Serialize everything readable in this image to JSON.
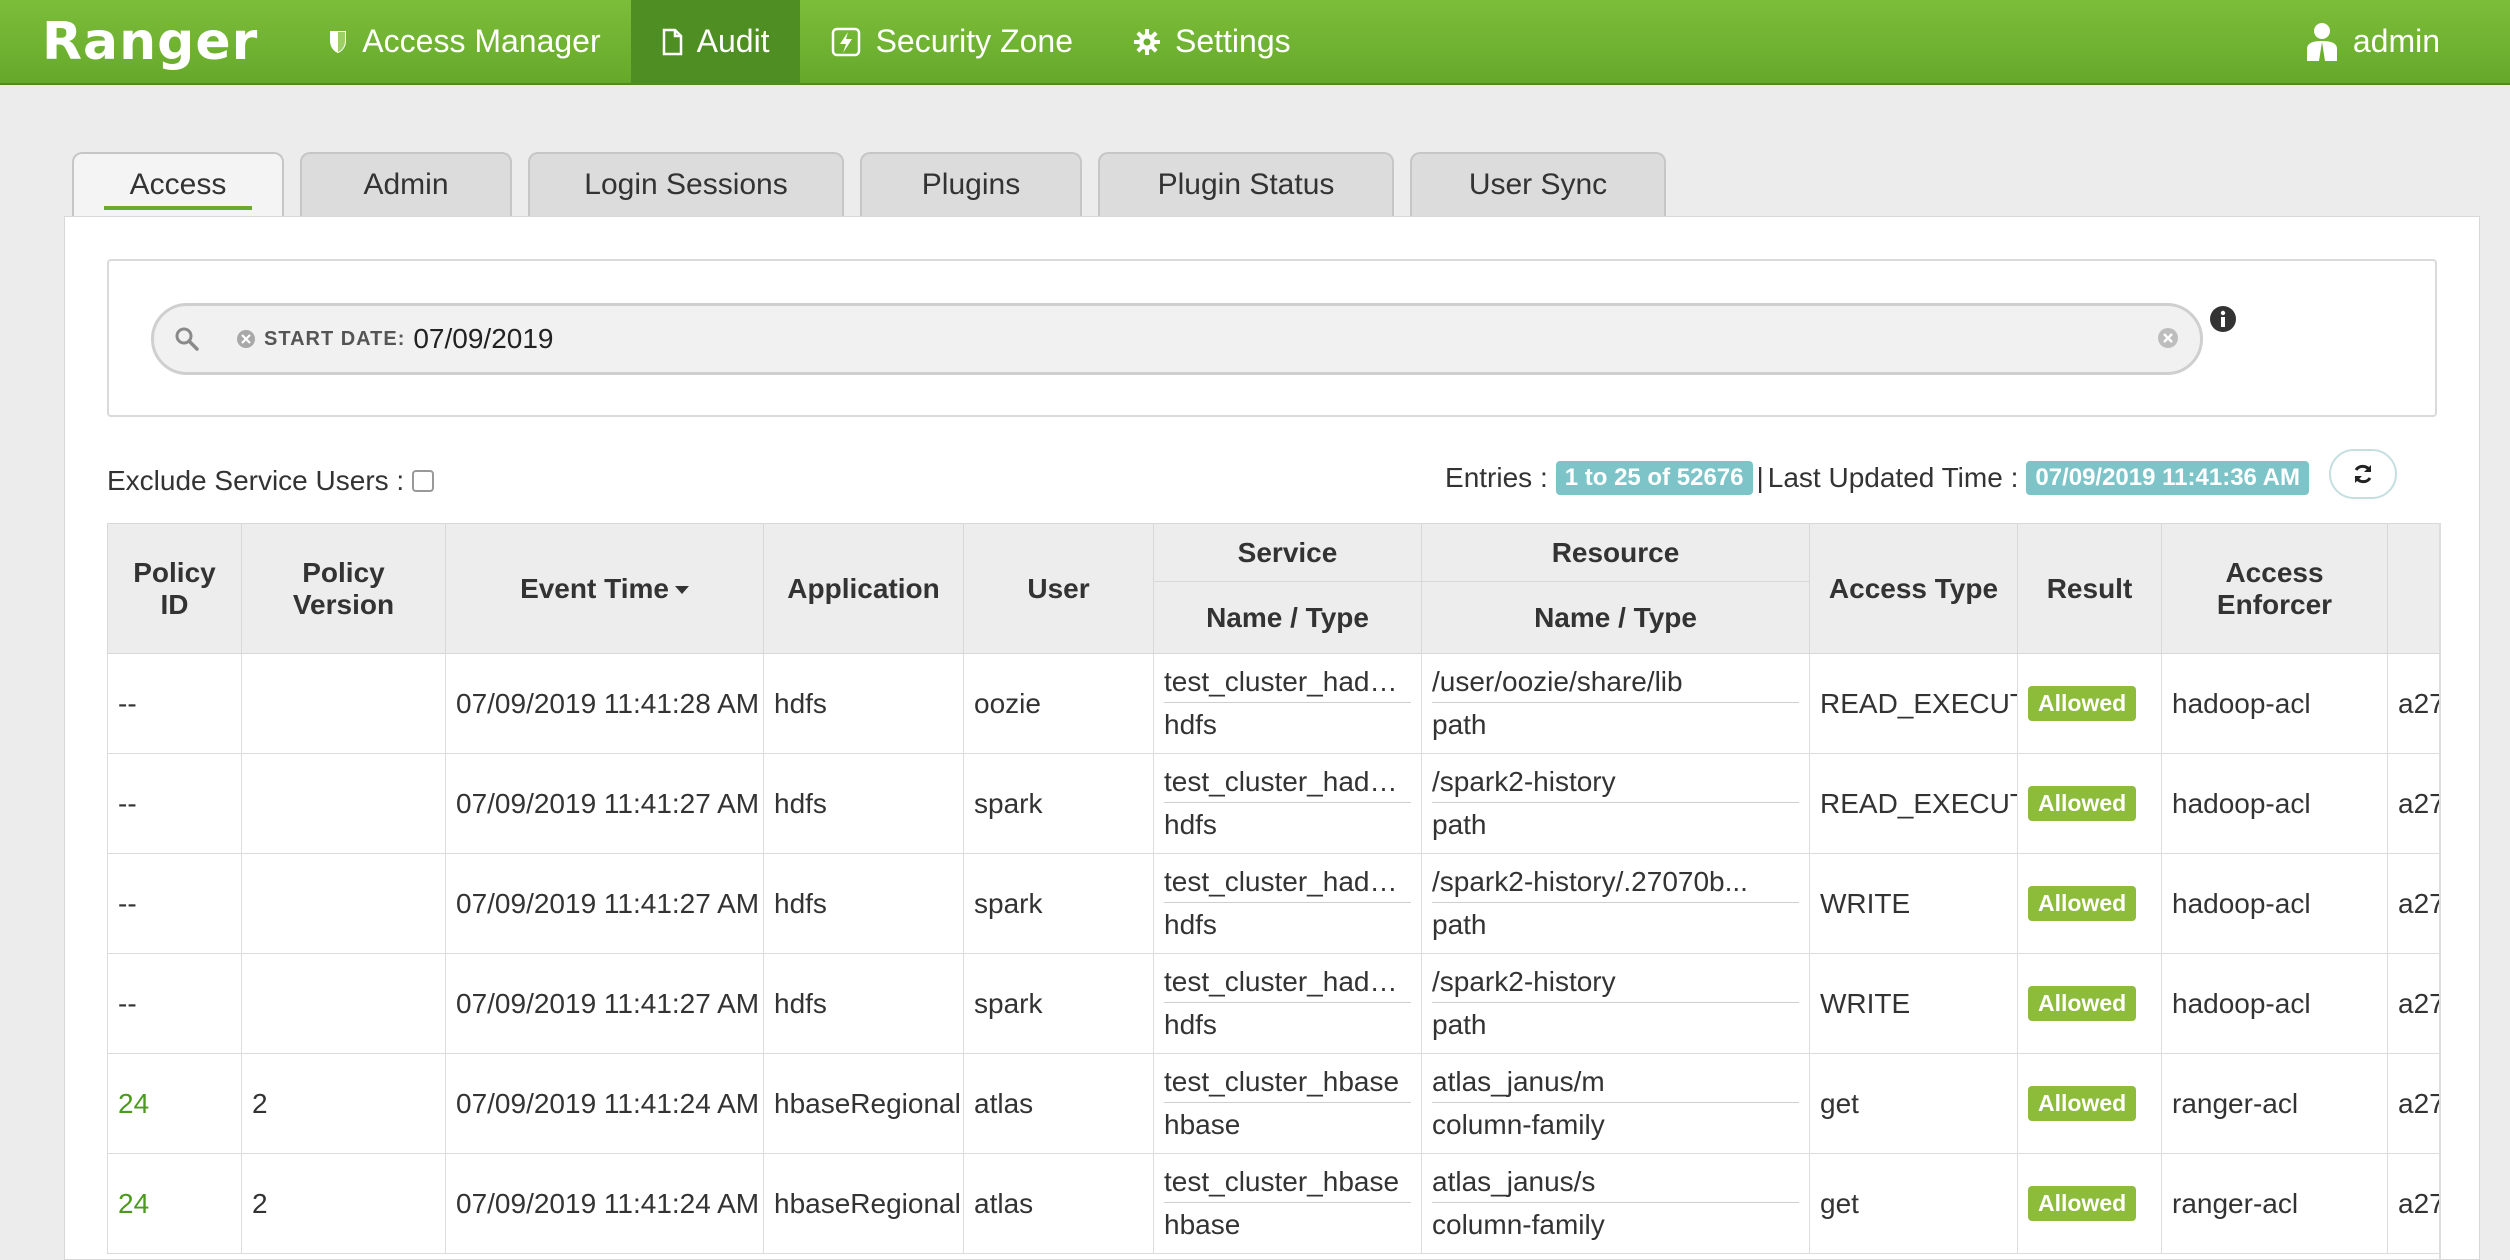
{
  "nav": {
    "brand": "Ranger",
    "items": [
      {
        "label": "Access Manager",
        "icon": "shield-icon"
      },
      {
        "label": "Audit",
        "icon": "file-icon"
      },
      {
        "label": "Security Zone",
        "icon": "lightning-icon"
      },
      {
        "label": "Settings",
        "icon": "gear-icon"
      }
    ],
    "active": "Audit",
    "user": "admin",
    "color_primary": "#72b533",
    "color_active": "#4f8e22"
  },
  "tabs": [
    {
      "label": "Access"
    },
    {
      "label": "Admin"
    },
    {
      "label": "Login Sessions"
    },
    {
      "label": "Plugins"
    },
    {
      "label": "Plugin Status"
    },
    {
      "label": "User Sync"
    }
  ],
  "search": {
    "facet_label": "START DATE:",
    "facet_value": "07/09/2019"
  },
  "filters": {
    "exclude_service_users_label": "Exclude Service Users :",
    "exclude_service_users_checked": false
  },
  "entries": {
    "label": "Entries :",
    "range": "1 to 25 of 52676",
    "separator": "|",
    "last_updated_label": "Last Updated Time :",
    "last_updated_value": "07/09/2019 11:41:36 AM"
  },
  "table": {
    "headers": {
      "policy_id": "Policy ID",
      "policy_version": "Policy Version",
      "event_time": "Event Time",
      "application": "Application",
      "user": "User",
      "service_group": "Service",
      "service_sub": "Name / Type",
      "resource_group": "Resource",
      "resource_sub": "Name / Type",
      "access_type": "Access Type",
      "result": "Result",
      "access_enforcer": "Access Enforcer"
    },
    "rows": [
      {
        "policy_id": "--",
        "policy_version": "",
        "event_time": "07/09/2019 11:41:28 AM",
        "application": "hdfs",
        "user": "oozie",
        "service_name": "test_cluster_hadoop",
        "service_type": "hdfs",
        "resource_name": "/user/oozie/share/lib",
        "resource_type": "path",
        "access_type": "READ_EXECUTE",
        "result": "Allowed",
        "access_enforcer": "hadoop-acl",
        "extra": "a27"
      },
      {
        "policy_id": "--",
        "policy_version": "",
        "event_time": "07/09/2019 11:41:27 AM",
        "application": "hdfs",
        "user": "spark",
        "service_name": "test_cluster_hadoop",
        "service_type": "hdfs",
        "resource_name": "/spark2-history",
        "resource_type": "path",
        "access_type": "READ_EXECUTE",
        "result": "Allowed",
        "access_enforcer": "hadoop-acl",
        "extra": "a27"
      },
      {
        "policy_id": "--",
        "policy_version": "",
        "event_time": "07/09/2019 11:41:27 AM",
        "application": "hdfs",
        "user": "spark",
        "service_name": "test_cluster_hadoop",
        "service_type": "hdfs",
        "resource_name": "/spark2-history/.27070b...",
        "resource_type": "path",
        "access_type": "WRITE",
        "result": "Allowed",
        "access_enforcer": "hadoop-acl",
        "extra": "a27"
      },
      {
        "policy_id": "--",
        "policy_version": "",
        "event_time": "07/09/2019 11:41:27 AM",
        "application": "hdfs",
        "user": "spark",
        "service_name": "test_cluster_hadoop",
        "service_type": "hdfs",
        "resource_name": "/spark2-history",
        "resource_type": "path",
        "access_type": "WRITE",
        "result": "Allowed",
        "access_enforcer": "hadoop-acl",
        "extra": "a27"
      },
      {
        "policy_id": "24",
        "policy_version": "2",
        "event_time": "07/09/2019 11:41:24 AM",
        "application": "hbaseRegional",
        "user": "atlas",
        "service_name": "test_cluster_hbase",
        "service_type": "hbase",
        "resource_name": "atlas_janus/m",
        "resource_type": "column-family",
        "access_type": "get",
        "result": "Allowed",
        "access_enforcer": "ranger-acl",
        "extra": "a27"
      },
      {
        "policy_id": "24",
        "policy_version": "2",
        "event_time": "07/09/2019 11:41:24 AM",
        "application": "hbaseRegional",
        "user": "atlas",
        "service_name": "test_cluster_hbase",
        "service_type": "hbase",
        "resource_name": "atlas_janus/s",
        "resource_type": "column-family",
        "access_type": "get",
        "result": "Allowed",
        "access_enforcer": "ranger-acl",
        "extra": "a27"
      }
    ]
  }
}
